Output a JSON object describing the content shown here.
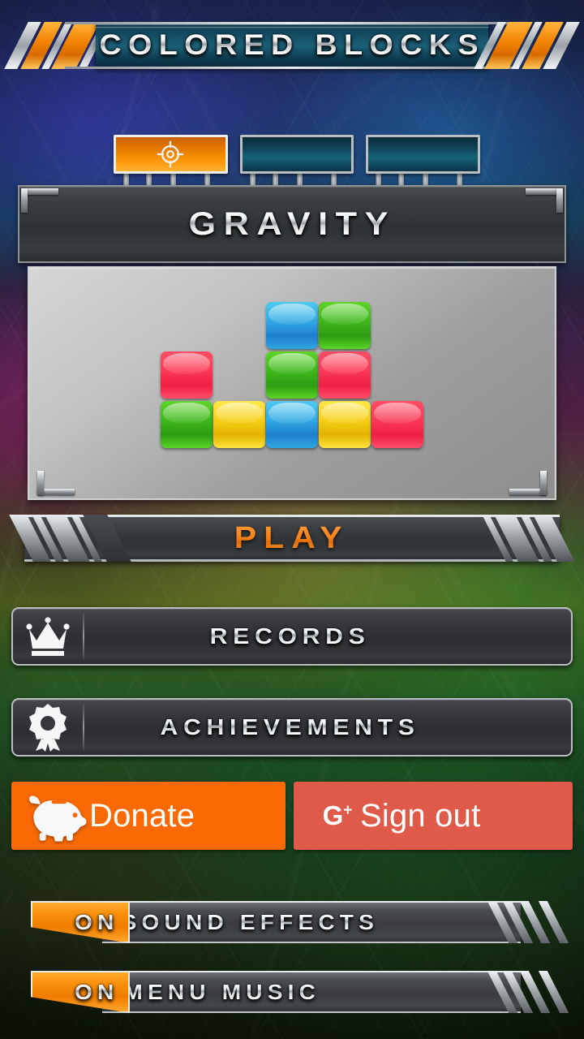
{
  "app": {
    "title": "COLORED BLOCKS",
    "accent_orange": "#f28b00",
    "accent_teal": "#17566e",
    "donate_color": "#f96a07",
    "signout_color": "#e05a4a"
  },
  "tabs": [
    {
      "name": "tab-mode-target",
      "icon": "target-icon",
      "active": true,
      "label": ""
    },
    {
      "name": "tab-mode-2",
      "icon": "",
      "active": false,
      "label": ""
    },
    {
      "name": "tab-mode-3",
      "icon": "",
      "active": false,
      "label": ""
    }
  ],
  "preview": {
    "mode_title": "GRAVITY",
    "grid": {
      "columns": 5,
      "rows": 3,
      "cells": [
        {
          "col": 2,
          "row": 0,
          "color": "blue"
        },
        {
          "col": 3,
          "row": 0,
          "color": "green"
        },
        {
          "col": 0,
          "row": 1,
          "color": "red"
        },
        {
          "col": 2,
          "row": 1,
          "color": "green"
        },
        {
          "col": 3,
          "row": 1,
          "color": "red"
        },
        {
          "col": 0,
          "row": 2,
          "color": "green"
        },
        {
          "col": 1,
          "row": 2,
          "color": "yellow"
        },
        {
          "col": 2,
          "row": 2,
          "color": "blue"
        },
        {
          "col": 3,
          "row": 2,
          "color": "yellow"
        },
        {
          "col": 4,
          "row": 2,
          "color": "red"
        }
      ],
      "palette": {
        "red": "#f01f45",
        "green": "#3fb81c",
        "blue": "#32aae4",
        "yellow": "#f6cf16"
      }
    }
  },
  "play": {
    "label": "PLAY"
  },
  "menu": {
    "records": {
      "label": "RECORDS",
      "icon": "crown-icon"
    },
    "achievements": {
      "label": "ACHIEVEMENTS",
      "icon": "medal-ribbon-icon"
    }
  },
  "social": {
    "donate": {
      "label": "Donate",
      "icon": "piggy-bank-icon"
    },
    "signout": {
      "label": "Sign out",
      "icon": "google-plus-icon"
    }
  },
  "settings": [
    {
      "name": "sound-effects",
      "label": "SOUND EFFECTS",
      "state": "ON"
    },
    {
      "name": "menu-music",
      "label": "MENU MUSIC",
      "state": "ON"
    }
  ]
}
